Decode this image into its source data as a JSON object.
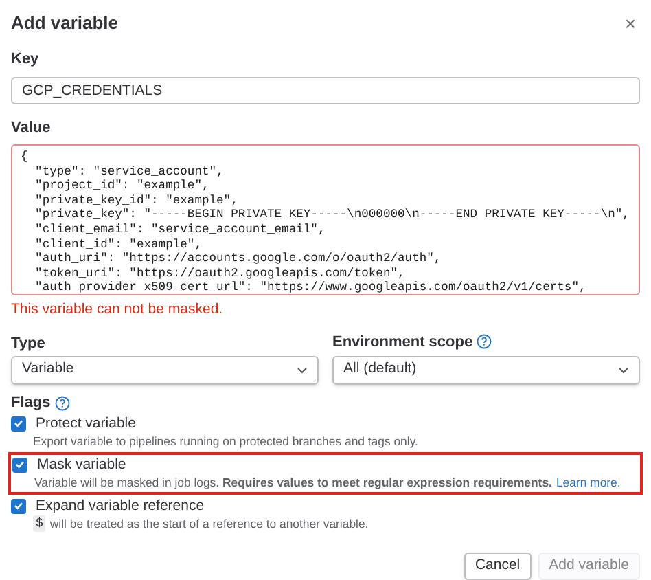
{
  "dialog": {
    "title": "Add variable",
    "close": "×"
  },
  "key": {
    "label": "Key",
    "value": "GCP_CREDENTIALS"
  },
  "value": {
    "label": "Value",
    "invalid": true,
    "lines": [
      "{",
      "  \"type\": \"service_account\",",
      "  \"project_id\": \"example\",",
      "  \"private_key_id\": \"example\",",
      "  \"private_key\": \"-----BEGIN PRIVATE KEY-----\\n000000\\n-----END PRIVATE KEY-----\\n\",",
      "  \"client_email\": \"service_account_email\",",
      "  \"client_id\": \"example\",",
      "  \"auth_uri\": \"https://accounts.google.com/o/oauth2/auth\",",
      "  \"token_uri\": \"https://oauth2.googleapis.com/token\",",
      "  \"auth_provider_x509_cert_url\": \"https://www.googleapis.com/oauth2/v1/certs\","
    ],
    "error": "This variable can not be masked."
  },
  "type": {
    "label": "Type",
    "value": "Variable"
  },
  "environment_scope": {
    "label": "Environment scope",
    "value": "All (default)"
  },
  "flags": {
    "label": "Flags",
    "items": [
      {
        "label": "Protect variable",
        "checked": true,
        "highlighted": false,
        "description": "Export variable to pipelines running on protected branches and tags only."
      },
      {
        "label": "Mask variable",
        "checked": true,
        "highlighted": true,
        "description": "Variable will be masked in job logs. **Requires values to meet regular expression requirements.**",
        "link": "Learn more."
      },
      {
        "label": "Expand variable reference",
        "checked": true,
        "highlighted": false,
        "code": "$",
        "description": "will be treated as the start of a reference to another variable."
      }
    ]
  },
  "buttons": [
    {
      "label": "Cancel",
      "disabled": false
    },
    {
      "label": "Add variable",
      "disabled": true
    }
  ]
}
